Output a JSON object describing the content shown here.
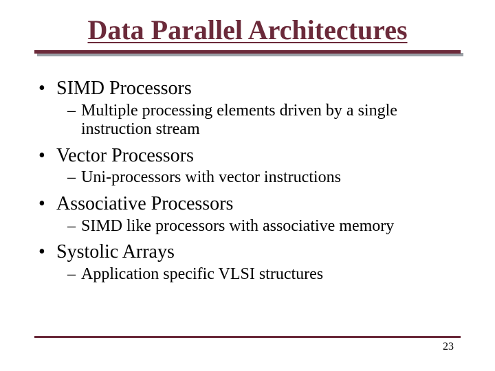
{
  "title": "Data Parallel Architectures",
  "bullets": [
    {
      "text": "SIMD Processors",
      "sub": "Multiple processing elements driven by a single instruction stream"
    },
    {
      "text": "Vector Processors",
      "sub": "Uni-processors with vector instructions"
    },
    {
      "text": "Associative Processors",
      "sub": "SIMD like processors with associative memory"
    },
    {
      "text": "Systolic Arrays",
      "sub": "Application specific VLSI structures"
    }
  ],
  "page_number": "23",
  "colors": {
    "accent": "#6b2a3a"
  }
}
